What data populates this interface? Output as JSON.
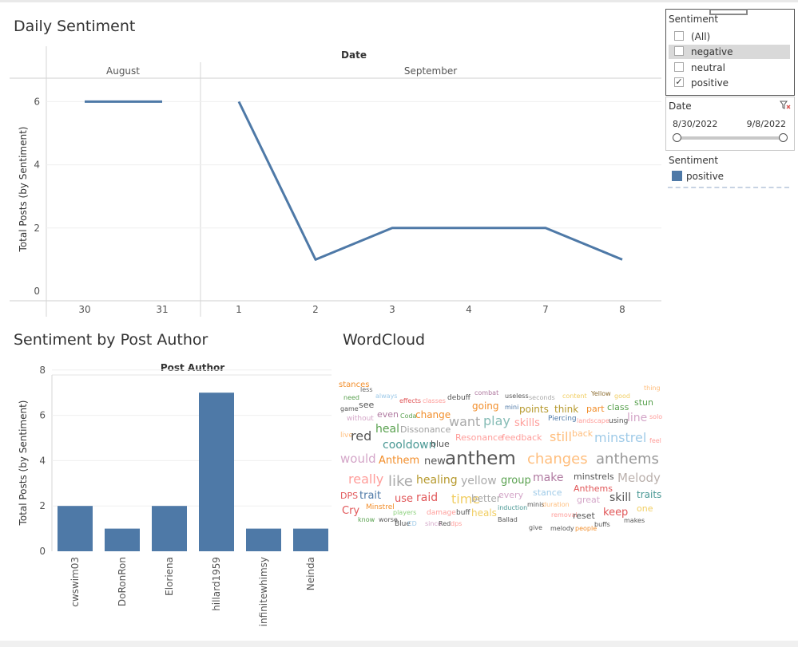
{
  "dashboard": {
    "daily_title": "Daily Sentiment",
    "author_title": "Sentiment by Post Author",
    "wordcloud_title": "WordCloud"
  },
  "filters": {
    "sentiment": {
      "title": "Sentiment",
      "options": [
        {
          "label": "(All)",
          "checked": false,
          "highlighted": false
        },
        {
          "label": "negative",
          "checked": false,
          "highlighted": true
        },
        {
          "label": "neutral",
          "checked": false,
          "highlighted": false
        },
        {
          "label": "positive",
          "checked": true,
          "highlighted": false
        }
      ]
    },
    "date": {
      "title": "Date",
      "start": "8/30/2022",
      "end": "9/8/2022",
      "icon": "clear-filter-icon"
    }
  },
  "legend": {
    "title": "Sentiment",
    "items": [
      {
        "label": "positive",
        "color": "#4e79a7"
      }
    ]
  },
  "colors": {
    "series": "#4e79a7",
    "close_icon": "#d9534f"
  },
  "chart_data": [
    {
      "type": "line",
      "title": "Daily Sentiment",
      "column_header": "Date",
      "groups": [
        {
          "label": "August",
          "x": [
            "30",
            "31"
          ]
        },
        {
          "label": "September",
          "x": [
            "1",
            "2",
            "3",
            "4",
            "7",
            "8"
          ]
        }
      ],
      "ylabel": "Total Posts (by Sentiment)",
      "ylim": [
        0,
        7
      ],
      "yticks": [
        0,
        2,
        4,
        6
      ],
      "grid": true,
      "series": [
        {
          "name": "positive",
          "color": "#4e79a7",
          "points": [
            {
              "x": "August 30",
              "y": 6
            },
            {
              "x": "August 31",
              "y": 6
            },
            {
              "x": "September 1",
              "y": 6
            },
            {
              "x": "September 2",
              "y": 1
            },
            {
              "x": "September 3",
              "y": 2
            },
            {
              "x": "September 4",
              "y": 2
            },
            {
              "x": "September 7",
              "y": 2
            },
            {
              "x": "September 8",
              "y": 1
            }
          ]
        }
      ]
    },
    {
      "type": "bar",
      "title": "Sentiment by Post Author",
      "column_header": "Post Author",
      "categories": [
        "cwswim03",
        "DoRonRon",
        "Eloriena",
        "hillard1959",
        "infinitewhimsy",
        "Neinda"
      ],
      "values": [
        2,
        1,
        2,
        7,
        1,
        1
      ],
      "ylabel": "Total Posts (by Sentiment)",
      "ylim": [
        0,
        8
      ],
      "yticks": [
        0,
        2,
        4,
        6,
        8
      ],
      "grid": true,
      "color": "#4e79a7"
    }
  ],
  "wordcloud": {
    "words": [
      {
        "t": "less",
        "c": "#666666"
      },
      {
        "t": "always",
        "c": "#9ecae9"
      },
      {
        "t": "effects",
        "c": "#e15759"
      },
      {
        "t": "classes",
        "c": "#ff9d9a"
      },
      {
        "t": "debuff",
        "c": "#555555"
      },
      {
        "t": "combat",
        "c": "#b07aa1"
      },
      {
        "t": "useless",
        "c": "#555555"
      },
      {
        "t": "seconds",
        "c": "#aaaaaa"
      },
      {
        "t": "content",
        "c": "#f1ce63"
      },
      {
        "t": "Yellow",
        "c": "#8c6d31"
      },
      {
        "t": "good",
        "c": "#f1ce63"
      },
      {
        "t": "thing",
        "c": "#ffbe7d"
      },
      {
        "t": "need",
        "c": "#59a14f"
      },
      {
        "t": "game",
        "c": "#555555"
      },
      {
        "t": "see",
        "c": "#555555"
      },
      {
        "t": "even",
        "c": "#b07aa1"
      },
      {
        "t": "Coda",
        "c": "#59a14f"
      },
      {
        "t": "change",
        "c": "#f28e2b"
      },
      {
        "t": "going",
        "c": "#f28e2b"
      },
      {
        "t": "mini",
        "c": "#4e79a7"
      },
      {
        "t": "points",
        "c": "#b6992d"
      },
      {
        "t": "think",
        "c": "#b6992d"
      },
      {
        "t": "part",
        "c": "#f28e2b"
      },
      {
        "t": "class",
        "c": "#59a14f"
      },
      {
        "t": "stun",
        "c": "#59a14f"
      },
      {
        "t": "without",
        "c": "#d4a6c8"
      },
      {
        "t": "want",
        "c": "#aaaaaa"
      },
      {
        "t": "play",
        "c": "#86bcb6"
      },
      {
        "t": "skills",
        "c": "#ff9d9a"
      },
      {
        "t": "Piercing",
        "c": "#4e79a7"
      },
      {
        "t": "landscape",
        "c": "#ff9d9a"
      },
      {
        "t": "using",
        "c": "#555555"
      },
      {
        "t": "line",
        "c": "#d4a6c8"
      },
      {
        "t": "solo",
        "c": "#ff9d9a"
      },
      {
        "t": "live",
        "c": "#ffbe7d"
      },
      {
        "t": "red",
        "c": "#555555"
      },
      {
        "t": "heal",
        "c": "#59a14f"
      },
      {
        "t": "Dissonance",
        "c": "#a0a0a0"
      },
      {
        "t": "Resonance",
        "c": "#ff9d9a"
      },
      {
        "t": "feedback",
        "c": "#ff9d9a"
      },
      {
        "t": "still",
        "c": "#ffbe7d"
      },
      {
        "t": "back",
        "c": "#ffbe7d"
      },
      {
        "t": "minstrel",
        "c": "#a0cbe8"
      },
      {
        "t": "feel",
        "c": "#ff9d9a"
      },
      {
        "t": "cooldown",
        "c": "#499894"
      },
      {
        "t": "blue",
        "c": "#555555"
      },
      {
        "t": "would",
        "c": "#d4a6c8"
      },
      {
        "t": "Anthem",
        "c": "#f28e2b"
      },
      {
        "t": "new",
        "c": "#555555"
      },
      {
        "t": "anthem",
        "c": "#555555"
      },
      {
        "t": "changes",
        "c": "#ffbe7d"
      },
      {
        "t": "anthems",
        "c": "#999999"
      },
      {
        "t": "really",
        "c": "#ff9d9a"
      },
      {
        "t": "like",
        "c": "#aaaaaa"
      },
      {
        "t": "healing",
        "c": "#b6992d"
      },
      {
        "t": "yellow",
        "c": "#aaaaaa"
      },
      {
        "t": "group",
        "c": "#59a14f"
      },
      {
        "t": "make",
        "c": "#b07aa1"
      },
      {
        "t": "Melody",
        "c": "#bab0ac"
      },
      {
        "t": "minstrels",
        "c": "#555555"
      },
      {
        "t": "Anthems",
        "c": "#e15759"
      },
      {
        "t": "DPS",
        "c": "#e15759"
      },
      {
        "t": "trait",
        "c": "#4e79a7"
      },
      {
        "t": "use",
        "c": "#e15759"
      },
      {
        "t": "raid",
        "c": "#e15759"
      },
      {
        "t": "time",
        "c": "#f1ce63"
      },
      {
        "t": "better",
        "c": "#aaaaaa"
      },
      {
        "t": "every",
        "c": "#d4a6c8"
      },
      {
        "t": "stance",
        "c": "#a0cbe8"
      },
      {
        "t": "great",
        "c": "#d4a6c8"
      },
      {
        "t": "skill",
        "c": "#555555"
      },
      {
        "t": "traits",
        "c": "#499894"
      },
      {
        "t": "Cry",
        "c": "#e15759"
      },
      {
        "t": "Minstrel",
        "c": "#f28e2b"
      },
      {
        "t": "players",
        "c": "#8cd17d"
      },
      {
        "t": "damage",
        "c": "#ff9d9a"
      },
      {
        "t": "buff",
        "c": "#555555"
      },
      {
        "t": "heals",
        "c": "#f1ce63"
      },
      {
        "t": "induction",
        "c": "#499894"
      },
      {
        "t": "minis",
        "c": "#555555"
      },
      {
        "t": "duration",
        "c": "#ffbe7d"
      },
      {
        "t": "removal",
        "c": "#ff9d9a"
      },
      {
        "t": "reset",
        "c": "#555555"
      },
      {
        "t": "keep",
        "c": "#e15759"
      },
      {
        "t": "one",
        "c": "#f1ce63"
      },
      {
        "t": "know",
        "c": "#59a14f"
      },
      {
        "t": "worse",
        "c": "#555555"
      },
      {
        "t": "Blue",
        "c": "#555555"
      },
      {
        "t": "CD",
        "c": "#a0cbe8"
      },
      {
        "t": "since",
        "c": "#d4a6c8"
      },
      {
        "t": "Red",
        "c": "#555555"
      },
      {
        "t": "dps",
        "c": "#ff9d9a"
      },
      {
        "t": "Ballad",
        "c": "#555555"
      },
      {
        "t": "give",
        "c": "#555555"
      },
      {
        "t": "melody",
        "c": "#555555"
      },
      {
        "t": "people",
        "c": "#f28e2b"
      },
      {
        "t": "buffs",
        "c": "#555555"
      },
      {
        "t": "makes",
        "c": "#555555"
      },
      {
        "t": "stances",
        "c": "#f28e2b"
      }
    ]
  }
}
